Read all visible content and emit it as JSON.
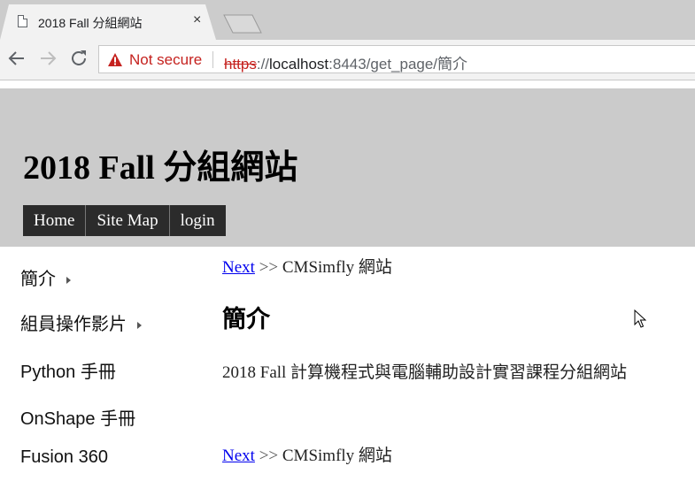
{
  "browser": {
    "tab_title": "2018 Fall 分組網站",
    "tab_close": "×",
    "security_label": "Not secure",
    "url_scheme": "https",
    "url_host": "localhost",
    "url_rest": ":8443/get_page/簡介"
  },
  "site": {
    "title": "2018 Fall 分組網站",
    "menu": [
      "Home",
      "Site Map",
      "login"
    ]
  },
  "sidebar": {
    "items": [
      {
        "label": "簡介",
        "has_submenu": true
      },
      {
        "label": "組員操作影片",
        "has_submenu": true
      },
      {
        "label": "Python 手冊",
        "has_submenu": false
      },
      {
        "label": "OnShape 手冊",
        "has_submenu": false
      },
      {
        "label": "Fusion 360",
        "has_submenu": false
      }
    ]
  },
  "content": {
    "nav_top": {
      "link": "Next",
      "sep": ">>",
      "text": "CMSimfly 網站"
    },
    "heading": "簡介",
    "intro": "2018 Fall 計算機程式與電腦輔助設計實習課程分組網站",
    "nav_bottom": {
      "link": "Next",
      "sep": ">>",
      "text": "CMSimfly 網站"
    }
  },
  "colors": {
    "header_bg": "#cbcbcb",
    "menu_bg": "#2b2b2b",
    "link": "#0000ee",
    "insecure": "#c5221f"
  }
}
